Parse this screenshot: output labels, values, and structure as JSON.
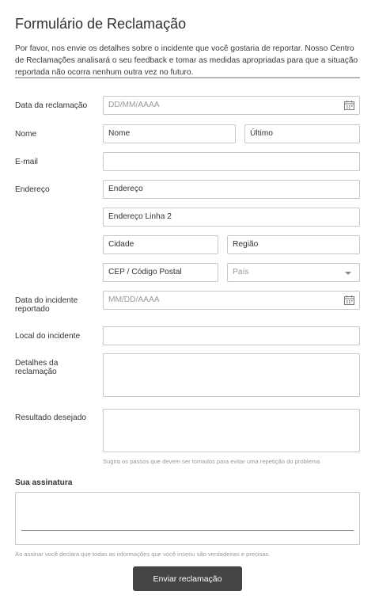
{
  "form": {
    "title": "Formulário de Reclamação",
    "intro": "Por favor, nos envie os detalhes sobre o incidente que você gostaria de reportar. Nosso Centro de Reclamações analisará o seu feedback e tomar as medidas apropriadas para que a situação reportada não ocorra nenhum outra vez no futuro."
  },
  "fields": {
    "complaint_date": {
      "label": "Data da reclamação",
      "placeholder": "DD/MM/AAAA",
      "icon": "calendar-icon"
    },
    "name": {
      "label": "Nome",
      "first_placeholder": "Nome",
      "last_placeholder": "Último"
    },
    "email": {
      "label": "E-mail"
    },
    "address": {
      "label": "Endereço",
      "line1": "Endereço",
      "line2": "Endereço Linha 2",
      "city": "Cidade",
      "region": "Região",
      "postal": "CEP / Código Postal",
      "country": "País"
    },
    "incident_date": {
      "label": "Data do incidente reportado",
      "placeholder": "MM/DD/AAAA",
      "icon": "calendar-icon"
    },
    "incident_location": {
      "label": "Local do incidente"
    },
    "details": {
      "label": "Detalhes da reclamação"
    },
    "desired_outcome": {
      "label": "Resultado desejado",
      "hint": "Sugira os passos que devem ser tomados para evitar uma repetição do problema"
    }
  },
  "signature": {
    "label": "Sua assinatura",
    "disclaimer": "Ao assinar você declara que todas as informações que você inseriu são verdadeiras e precisas."
  },
  "submit_label": "Enviar reclamação"
}
